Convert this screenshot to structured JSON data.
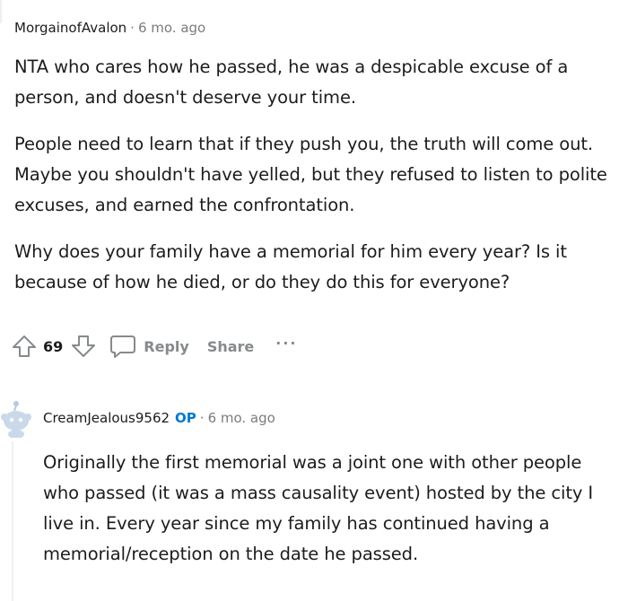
{
  "comments": [
    {
      "author": "MorgainofAvalon",
      "separator": "·",
      "time": "6 mo. ago",
      "paragraphs": [
        "NTA who cares how he passed, he was a despicable excuse of a person, and doesn't deserve your time.",
        "People need to learn that if they push you, the truth will come out. Maybe you shouldn't have yelled, but they refused to listen to polite excuses, and earned the confrontation.",
        "Why does your family have a memorial for him every year? Is it because of how he died, or do they do this for everyone?"
      ],
      "actions": {
        "score": "69",
        "reply_label": "Reply",
        "share_label": "Share",
        "more_label": "···"
      }
    },
    {
      "author": "CreamJealous9562",
      "op_badge": "OP",
      "separator": "·",
      "time": "6 mo. ago",
      "paragraphs": [
        "Originally the first memorial was a joint one with other people who passed (it was a mass causality event) hosted by the city I live in. Every year since my family has continued having a memorial/reception on the date he passed."
      ]
    }
  ],
  "colors": {
    "text": "#1c1c1c",
    "meta": "#7c7c7c",
    "action_gray": "#878a8c",
    "op_blue": "#0079d3",
    "thread_line": "#edeff1",
    "avatar_blue": "#c9d9ea"
  },
  "icons": {
    "upvote": "arrow-up-icon",
    "downvote": "arrow-down-icon",
    "reply": "speech-bubble-icon",
    "avatar": "snoo-avatar-icon"
  }
}
